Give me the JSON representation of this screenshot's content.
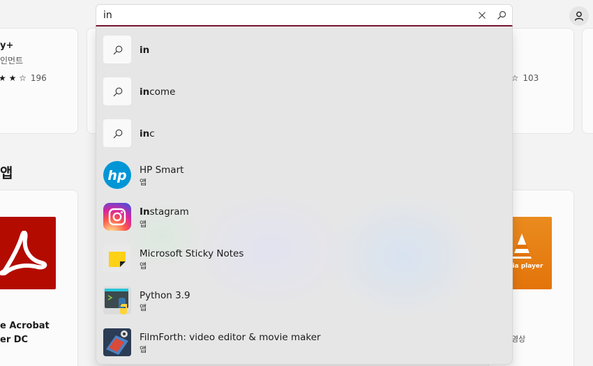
{
  "search": {
    "query": "in",
    "clear_icon": "close-icon",
    "submit_icon": "search-icon"
  },
  "suggestions": {
    "queries": [
      {
        "bold": "in",
        "rest": ""
      },
      {
        "bold": "in",
        "rest": "come"
      },
      {
        "bold": "in",
        "rest": "c"
      }
    ],
    "apps": [
      {
        "name": "HP Smart",
        "sub": "앱",
        "icon": "hp-smart-icon"
      },
      {
        "bold": "In",
        "rest": "stagram",
        "sub": "앱",
        "icon": "instagram-icon"
      },
      {
        "name": "Microsoft Sticky Notes",
        "sub": "앱",
        "icon": "sticky-notes-icon"
      },
      {
        "name": "Python 3.9",
        "sub": "앱",
        "icon": "python-icon"
      },
      {
        "name": "FilmForth: video editor & movie maker",
        "sub": "앱",
        "icon": "filmforth-icon"
      }
    ]
  },
  "background": {
    "card1_title": "y+",
    "card1_subtitle": "인먼트",
    "card1_rating_count": "196",
    "card3_rating_count": "103",
    "section_heading": "앱",
    "app1_title_line1": "e Acrobat",
    "app1_title_line2": "er DC",
    "vlc_label": "dia player",
    "vlc_subtitle": "영상"
  },
  "colors": {
    "accent": "#7a1631",
    "acrobat": "#b30b00",
    "vlc": "#e3740a",
    "hp": "#0096d6"
  }
}
